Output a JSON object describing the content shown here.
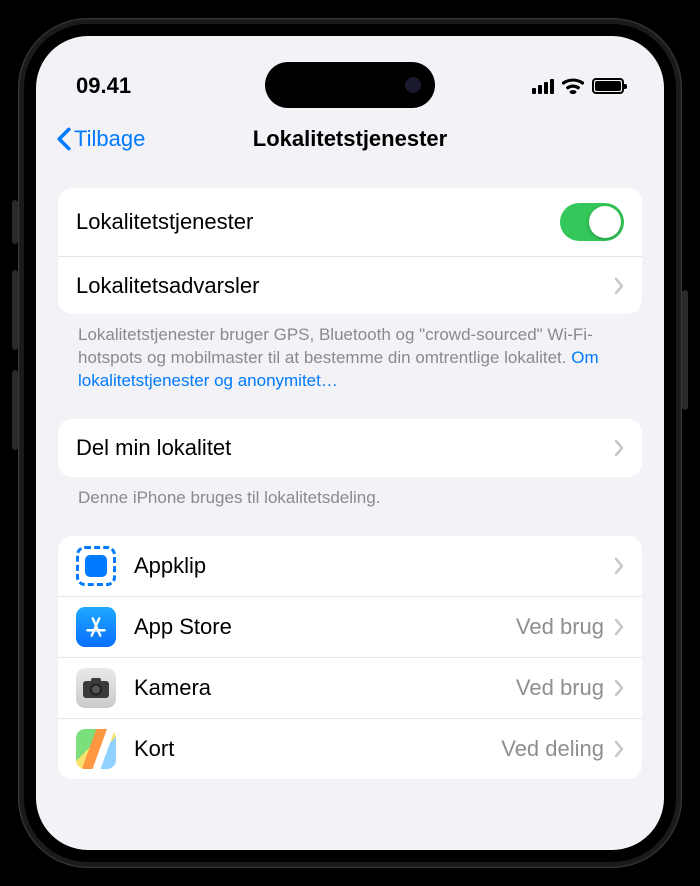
{
  "statusBar": {
    "time": "09.41"
  },
  "nav": {
    "back": "Tilbage",
    "title": "Lokalitetstjenester"
  },
  "group1": {
    "locationServicesLabel": "Lokalitetstjenester",
    "locationAlertsLabel": "Lokalitetsadvarsler"
  },
  "footer1": {
    "text": "Lokalitetstjenester bruger GPS, Bluetooth og \"crowd-sourced\" Wi-Fi-hotspots og mobilmaster til at bestemme din omtrentlige lokalitet. ",
    "link": "Om lokalitetstjenester og anonymitet…"
  },
  "group2": {
    "shareLabel": "Del min lokalitet"
  },
  "footer2": {
    "text": "Denne iPhone bruges til lokalitetsdeling."
  },
  "apps": [
    {
      "name": "Appklip",
      "value": "",
      "icon": "appclip"
    },
    {
      "name": "App Store",
      "value": "Ved brug",
      "icon": "appstore"
    },
    {
      "name": "Kamera",
      "value": "Ved brug",
      "icon": "camera"
    },
    {
      "name": "Kort",
      "value": "Ved deling",
      "icon": "maps"
    }
  ]
}
